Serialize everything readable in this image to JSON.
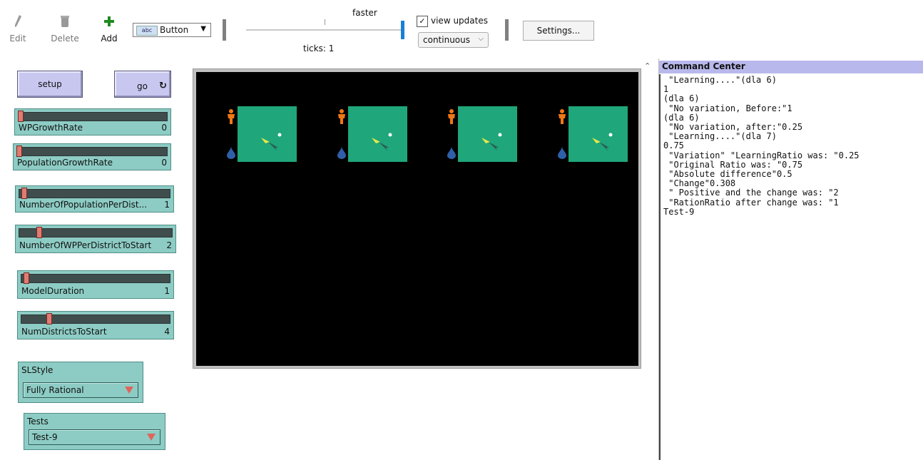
{
  "toolbar": {
    "edit_label": "Edit",
    "delete_label": "Delete",
    "add_label": "Add",
    "widget_type": "Button",
    "widget_type_icon": "abc",
    "speed_label": "faster",
    "ticks_label": "ticks: 1",
    "view_updates_label": "view updates",
    "view_updates_checked": "✓",
    "update_mode": "continuous",
    "settings_label": "Settings..."
  },
  "buttons": {
    "setup_label": "setup",
    "go_label": "go"
  },
  "sliders": [
    {
      "name": "WPGrowthRate",
      "value": "0",
      "fraction": 0.0
    },
    {
      "name": "PopulationGrowthRate",
      "value": "0",
      "fraction": 0.0
    },
    {
      "name": "NumberOfPopulationPerDist...",
      "value": "1",
      "fraction": 0.02
    },
    {
      "name": "NumberOfWPPerDistrictToStart",
      "value": "2",
      "fraction": 0.12
    },
    {
      "name": "ModelDuration",
      "value": "1",
      "fraction": 0.02
    },
    {
      "name": "NumDistrictsToStart",
      "value": "4",
      "fraction": 0.18
    }
  ],
  "choosers": [
    {
      "name": "SLStyle",
      "value": "Fully Rational"
    },
    {
      "name": "Tests",
      "value": "Test-9"
    }
  ],
  "colors": {
    "button": "#c8c7f0",
    "slider": "#8dccc4",
    "district_patch": "#1fa67a",
    "person_icon": "#f07814",
    "water_icon": "#2f5fa8",
    "world_bg": "#000000"
  },
  "world": {
    "district_count": 4,
    "icons": [
      "person-icon",
      "water-drop-icon",
      "arrow-cursor-icon"
    ]
  },
  "command_center": {
    "title": "Command Center",
    "output": " \"Learning....\"(dla 6)\n1\n(dla 6)\n \"No variation, Before:\"1\n(dla 6)\n \"No variation, after:\"0.25\n \"Learning....\"(dla 7)\n0.75\n \"Variation\" \"LearningRatio was: \"0.25\n \"Original Ratio was: \"0.75\n \"Absolute difference\"0.5\n \"Change\"0.308\n \" Positive and the change was: \"2\n \"RationRatio after change was: \"1\nTest-9"
  }
}
